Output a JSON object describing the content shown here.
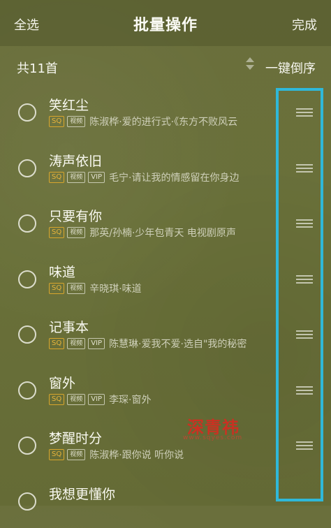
{
  "header": {
    "select_all": "全选",
    "title": "批量操作",
    "done": "完成"
  },
  "subbar": {
    "count": "共11首",
    "reverse_label": "一键倒序"
  },
  "songs": [
    {
      "title": "笑红尘",
      "badges": [
        "SQ",
        "视频"
      ],
      "subtitle": "陈淑桦·爱的进行式·《东方不败风云"
    },
    {
      "title": "涛声依旧",
      "badges": [
        "SQ",
        "视频",
        "VIP"
      ],
      "subtitle": "毛宁·请让我的情感留在你身边"
    },
    {
      "title": "只要有你",
      "badges": [
        "SQ",
        "视频"
      ],
      "subtitle": "那英/孙楠·少年包青天 电视剧原声"
    },
    {
      "title": "味道",
      "badges": [
        "SQ",
        "视频"
      ],
      "subtitle": "辛晓琪·味道"
    },
    {
      "title": "记事本",
      "badges": [
        "SQ",
        "视频",
        "VIP"
      ],
      "subtitle": "陈慧琳·爱我不爱·选自\"我的秘密"
    },
    {
      "title": "窗外",
      "badges": [
        "SQ",
        "视频",
        "VIP"
      ],
      "subtitle": "李琛·窗外"
    },
    {
      "title": "梦醒时分",
      "badges": [
        "SQ",
        "视频"
      ],
      "subtitle": "陈淑桦·跟你说 听你说"
    },
    {
      "title": "我想更懂你",
      "badges": [],
      "subtitle": ""
    }
  ],
  "watermark": {
    "text": "深青祎",
    "sub": "www.sqyes.com"
  },
  "colors": {
    "highlight": "#2fb8d9",
    "sq_badge": "#d9a62c"
  }
}
